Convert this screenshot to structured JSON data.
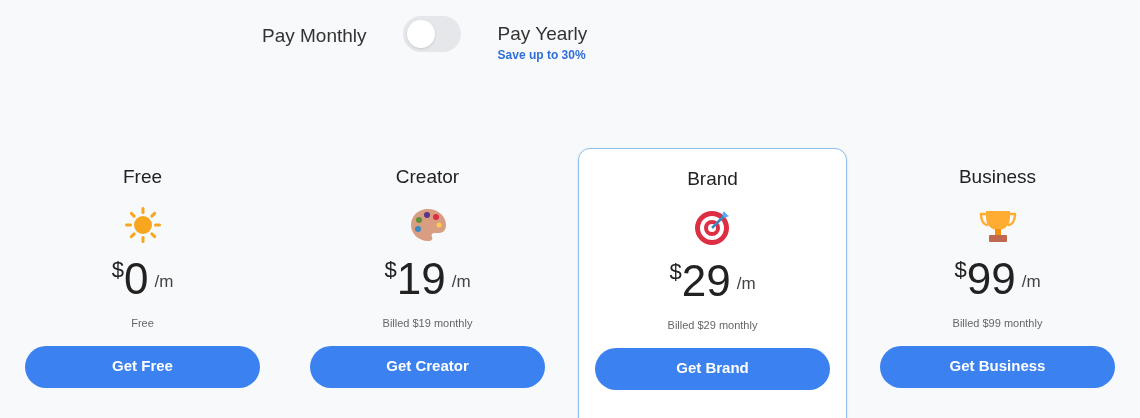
{
  "billing": {
    "monthly_label": "Pay Monthly",
    "toggle": {
      "on": false
    },
    "yearly_label": "Pay Yearly",
    "savings_note": "Save up to 30%"
  },
  "plans": [
    {
      "name": "Free",
      "kind": "sun",
      "currency": "$",
      "price": "0",
      "period": "/m",
      "billing_note": "Free",
      "button": "Get Free",
      "selected": false
    },
    {
      "name": "Creator",
      "kind": "palette",
      "currency": "$",
      "price": "19",
      "period": "/m",
      "billing_note": "Billed $19 monthly",
      "button": "Get Creator",
      "selected": false
    },
    {
      "name": "Brand",
      "kind": "target",
      "currency": "$",
      "price": "29",
      "period": "/m",
      "billing_note": "Billed $29 monthly",
      "button": "Get Brand",
      "selected": true
    },
    {
      "name": "Business",
      "kind": "trophy",
      "currency": "$",
      "price": "99",
      "period": "/m",
      "billing_note": "Billed $99 monthly",
      "button": "Get Business",
      "selected": false
    }
  ]
}
